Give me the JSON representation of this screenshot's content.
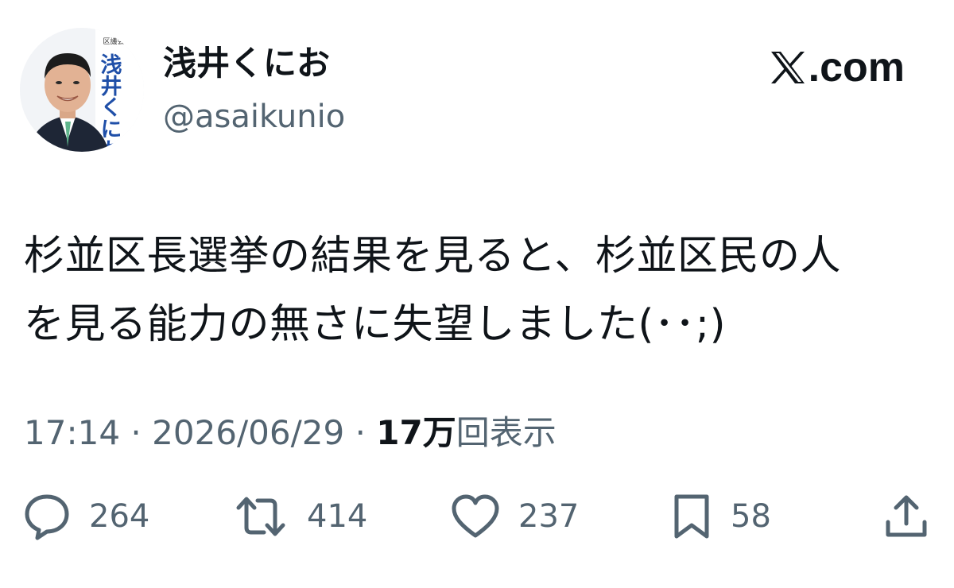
{
  "author": {
    "display_name": "浅井くにお",
    "handle": "@asaikunio",
    "avatar_badge_text": "浅井くにお",
    "avatar_caption": "区議会議員"
  },
  "brand": {
    "icon": "x-logo-icon",
    "text": ".com"
  },
  "tweet": {
    "lines": [
      "杉並区長選挙の結果を見ると、杉並区民の人",
      "を見る能力の無さに失望しました(･･;)"
    ]
  },
  "meta": {
    "time": "17:14",
    "separator": "·",
    "date": "2026/06/29",
    "views_count": "17万",
    "views_label": "回表示"
  },
  "actions": {
    "reply": {
      "icon": "reply-icon",
      "count": "264"
    },
    "repost": {
      "icon": "repost-icon",
      "count": "414"
    },
    "like": {
      "icon": "heart-icon",
      "count": "237"
    },
    "bookmark": {
      "icon": "bookmark-icon",
      "count": "58"
    },
    "share": {
      "icon": "share-icon"
    }
  },
  "colors": {
    "text_primary": "#0f1419",
    "text_secondary": "#536471",
    "avatar_banner": "#1f4fa8"
  }
}
